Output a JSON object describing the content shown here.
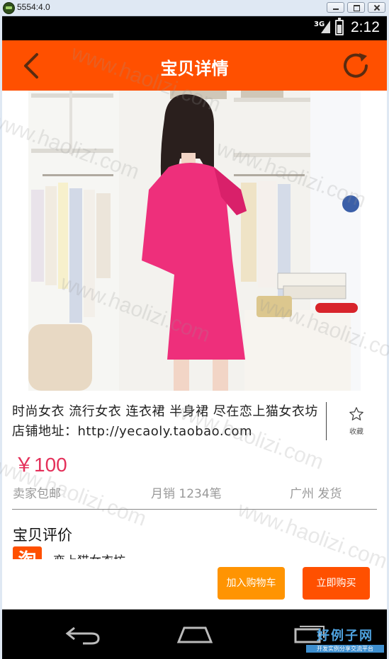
{
  "window": {
    "title": "5554:4.0"
  },
  "status_bar": {
    "network": "3G",
    "time": "2:12"
  },
  "header": {
    "title": "宝贝详情",
    "back_icon": "chevron-left-icon",
    "refresh_icon": "refresh-icon"
  },
  "product": {
    "title": "时尚女衣  流行女衣  连衣裙  半身裙  尽在恋上猫女衣坊 店铺地址：http://yecaoly.taobao.com",
    "price": "￥100",
    "shipping": "卖家包邮",
    "sales": "月销  1234笔",
    "location": "广州  发货",
    "favorite_label": "收藏"
  },
  "reviews": {
    "title": "宝贝评价",
    "shop_icon_text": "淘",
    "shop_name": "恋上猫女衣坊"
  },
  "actions": {
    "add_to_cart": "加入购物车",
    "buy_now": "立即购买"
  },
  "watermark": {
    "text": "www.haolizi.com",
    "logo_top": "好例子网",
    "logo_bottom": "开发实例分享交流平台"
  },
  "colors": {
    "accent": "#ff5000",
    "cart_button": "#ff9402",
    "price": "#e4305a"
  }
}
